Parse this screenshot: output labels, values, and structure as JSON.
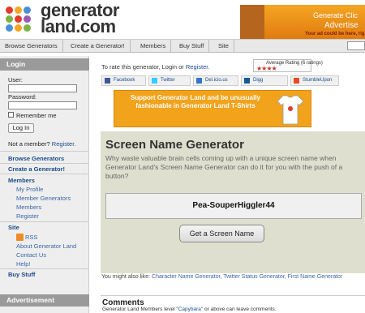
{
  "header": {
    "logo_text": "generator land.com",
    "logo_line1": "generator",
    "logo_line2": "land.com",
    "dot_colors": [
      "#e23b2e",
      "#f5a623",
      "#4a90d9",
      "#7cb342",
      "#e23b2e",
      "#9b59b6",
      "#4a90d9",
      "#f5a623",
      "#7cb342"
    ],
    "ad": {
      "line1": "Generate Clic",
      "line2": "Advertise",
      "line3": "Your ad could be here, rig"
    }
  },
  "nav": {
    "items": [
      "Browse Generators",
      "Create a Generator!",
      "Members",
      "Buy Stuff",
      "Site"
    ]
  },
  "sidebar": {
    "login_header": "Login",
    "user_label": "User:",
    "password_label": "Password:",
    "remember_label": "Remember me",
    "login_button": "Log In",
    "not_member": "Not a member?",
    "register_link": "Register.",
    "browse": "Browse Generators",
    "create": "Create a Generator!",
    "members_header": "Members",
    "members_links": [
      "My Profile",
      "Member Generators",
      "Members",
      "Register"
    ],
    "site_header": "Site",
    "site_links": [
      "RSS",
      "About Generator Land",
      "Contact Us",
      "Help!"
    ],
    "buy_stuff": "Buy Stuff",
    "advertisement_header": "Advertisement"
  },
  "main": {
    "rate_prefix": "To rate this generator,",
    "rate_login": "Login",
    "rate_or": "or",
    "rate_register": "Register.",
    "rating_label": "Average Rating (6 ratings)",
    "rating_stars": "★★★★",
    "share": [
      {
        "label": "Facebook",
        "icon": "facebook-icon",
        "color": "#3b5998"
      },
      {
        "label": "Twitter",
        "icon": "twitter-icon",
        "color": "#33ccff"
      },
      {
        "label": "Del.icio.us",
        "icon": "delicious-icon",
        "color": "#3274d0"
      },
      {
        "label": "Digg",
        "icon": "digg-icon",
        "color": "#14589e"
      },
      {
        "label": "StumbleUpon",
        "icon": "stumbleupon-icon",
        "color": "#eb4924"
      }
    ],
    "tshirt_ad": "Support Generator Land and be unusually fashionable in Generator Land T-Shirts",
    "generator_title": "Screen Name Generator",
    "generator_desc": "Why waste valuable brain cells coming up with a unique screen name when Generator Land's Screen Name Generator can do it for you with the push of a button?",
    "result": "Pea-SouperHiggler44",
    "button": "Get a Screen Name",
    "also_prefix": "You might also like:",
    "also_links": [
      "Character Name Generator",
      "Twitter Status Generator",
      "First Name Generator"
    ],
    "comments_title": "Comments",
    "comments_sub_prefix": "Generator Land Members level",
    "comments_level": "\"Capybara\"",
    "comments_sub_suffix": "or above can leave comments."
  }
}
